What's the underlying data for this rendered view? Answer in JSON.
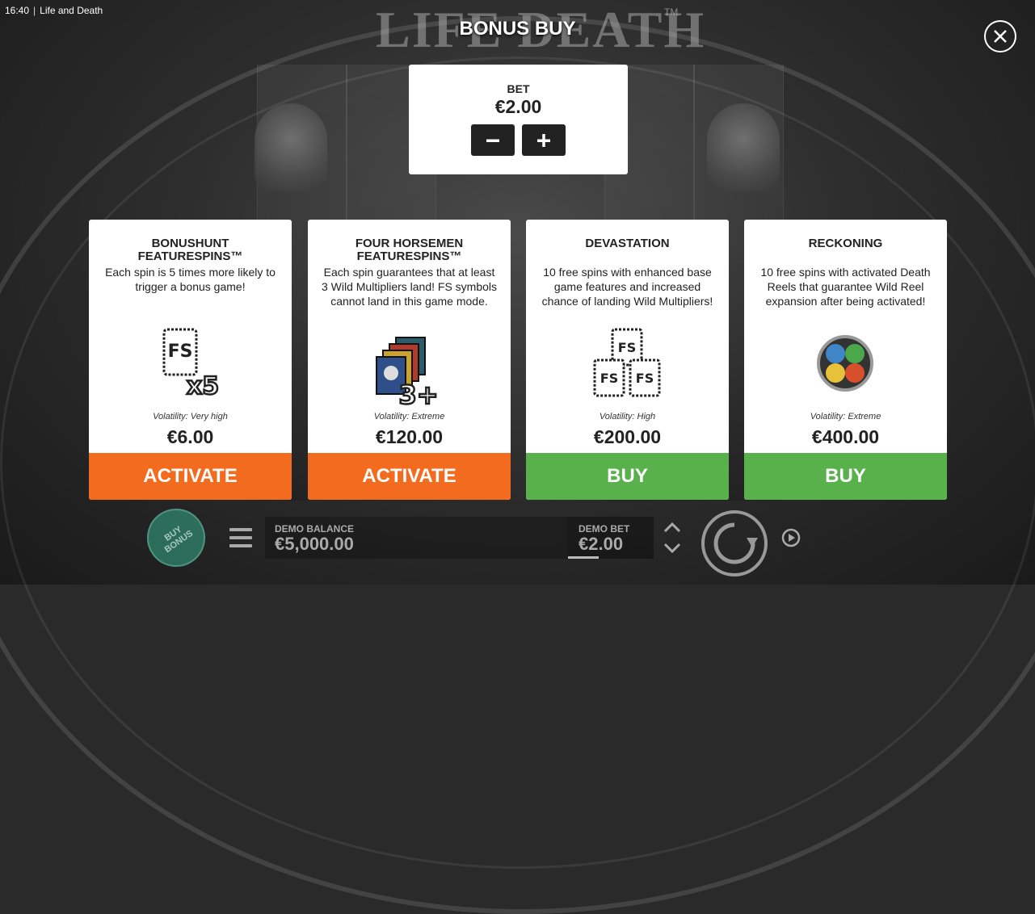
{
  "status_bar": {
    "time": "16:40",
    "separator": "|",
    "app_title": "Life and Death"
  },
  "game_logo": {
    "text": "LIFE DEATH",
    "tm": "TM"
  },
  "dialog": {
    "title": "BONUS BUY",
    "close_icon": "close-icon"
  },
  "bet": {
    "label": "BET",
    "value": "€2.00",
    "decrease_icon": "minus-icon",
    "increase_icon": "plus-icon"
  },
  "cards": [
    {
      "title": "BONUSHUNT FEATURESPINS™",
      "description": "Each spin is 5 times more likely to trigger a bonus game!",
      "icon": "fs-x5-icon",
      "volatility": "Volatility: Very high",
      "price": "€6.00",
      "button": "ACTIVATE",
      "button_color": "#f36b1f"
    },
    {
      "title": "FOUR HORSEMEN FEATURESPINS™",
      "description": "Each spin guarantees that at least 3 Wild Multipliers land! FS symbols cannot land in this game mode.",
      "icon": "horsemen-3plus-icon",
      "volatility": "Volatility: Extreme",
      "price": "€120.00",
      "button": "ACTIVATE",
      "button_color": "#f36b1f"
    },
    {
      "title": "DEVASTATION",
      "description": "10 free spins with enhanced base game features and increased chance of landing Wild Multipliers!",
      "icon": "fs-triple-icon",
      "volatility": "Volatility: High",
      "price": "€200.00",
      "button": "BUY",
      "button_color": "#58b14b"
    },
    {
      "title": "RECKONING",
      "description": "10 free spins with activated Death Reels that guarantee Wild Reel expansion after being activated!",
      "icon": "stained-glass-orb-icon",
      "volatility": "Volatility: Extreme",
      "price": "€400.00",
      "button": "BUY",
      "button_color": "#58b14b"
    }
  ],
  "bottom_bar": {
    "buy_bonus": "BUY BONUS",
    "menu_icon": "hamburger-menu-icon",
    "demo_balance_label": "DEMO BALANCE",
    "demo_balance_value": "€5,000.00",
    "demo_bet_label": "DEMO BET",
    "demo_bet_value": "€2.00",
    "bet_arrows_icon": "up-down-chevron-icon",
    "spin_icon": "spin-arrow-icon",
    "autoplay_icon": "autoplay-icon"
  }
}
